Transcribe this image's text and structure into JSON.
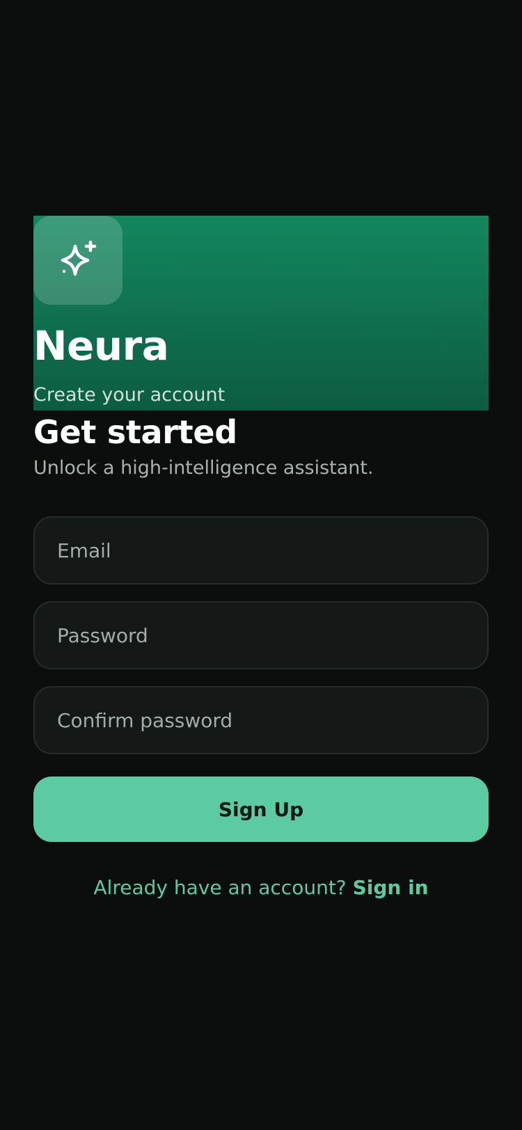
{
  "theme": {
    "background": "#0b0e0d",
    "hero_gradient_top": "#13875f",
    "hero_gradient_bottom": "#0c5c41",
    "accent": "#5ccba4"
  },
  "hero": {
    "logo_icon": "sparkles-icon",
    "brand": "Neura",
    "subtitle": "Create your account"
  },
  "form": {
    "heading": "Get started",
    "subheading": "Unlock a high-intelligence assistant.",
    "email": {
      "value": "",
      "placeholder": "Email"
    },
    "password": {
      "value": "",
      "placeholder": "Password"
    },
    "confirm_password": {
      "value": "",
      "placeholder": "Confirm password"
    },
    "submit_label": "Sign Up"
  },
  "footer": {
    "prompt": "Already have an account? ",
    "link_label": "Sign in"
  }
}
